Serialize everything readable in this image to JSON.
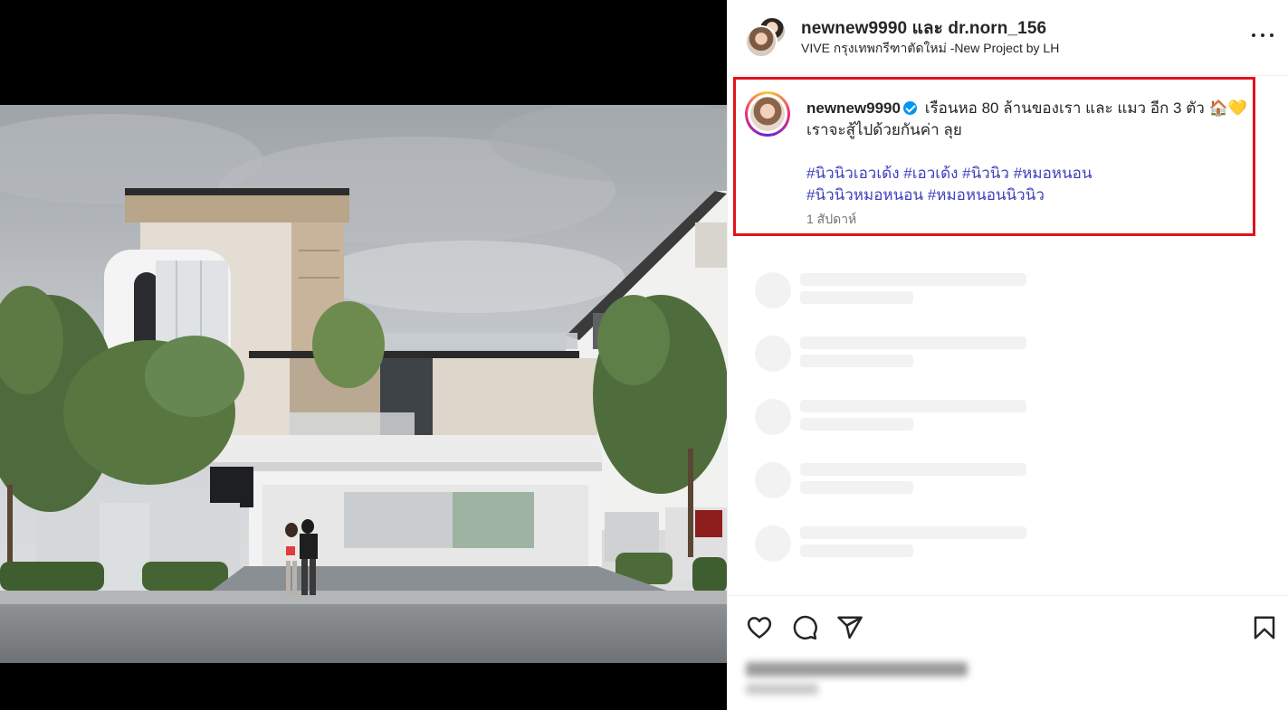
{
  "header": {
    "user_one": "newnew9990",
    "conjunction": "และ",
    "user_two": "dr.norn_156",
    "location": "VIVE กรุงเทพกรีฑาตัดใหม่ -New Project by LH",
    "more_icon": "more-horizontal-icon"
  },
  "caption": {
    "username": "newnew9990",
    "verified": true,
    "text_line1": "เรือนหอ 80 ล้านของเรา และ แมว อีก 3 ตัว",
    "emoji_house": "🏠",
    "emoji_heart": "💛",
    "text_line2": "เราจะสู้ไปด้วยกันค่า ลุย",
    "hashtags": [
      "#นิวนิวเอวเด้ง",
      "#เอวเด้ง",
      "#นิวนิว",
      "#หมอหนอน",
      "#นิวนิวหมอหนอน",
      "#หมอหนอนนิวนิว"
    ],
    "time_ago": "1 สัปดาห์",
    "highlight_color": "#e0141c"
  },
  "actions": {
    "like": "heart-icon",
    "comment": "comment-icon",
    "share": "send-icon",
    "save": "bookmark-icon"
  },
  "media": {
    "description_icon": "photo"
  }
}
